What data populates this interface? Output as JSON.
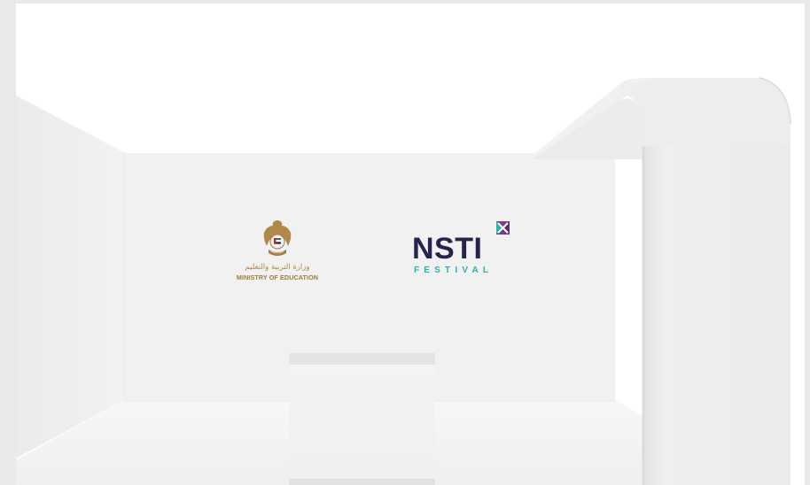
{
  "ministry_logo": {
    "arabic_text": "وزارة التربية والتعليم",
    "english_text": "MINISTRY OF EDUCATION",
    "emblem_icon": "uae-falcon-emblem-icon",
    "color": "#9b7a3e"
  },
  "nsti_logo": {
    "wordmark": "NSTI",
    "subtitle": "FESTIVAL",
    "mark_icon": "x-square-icon",
    "colors": {
      "wordmark": "#26234f",
      "subtitle": "#2cb3a8",
      "mark_primary": "#7a3a8e",
      "mark_secondary": "#2cb3a8"
    }
  }
}
